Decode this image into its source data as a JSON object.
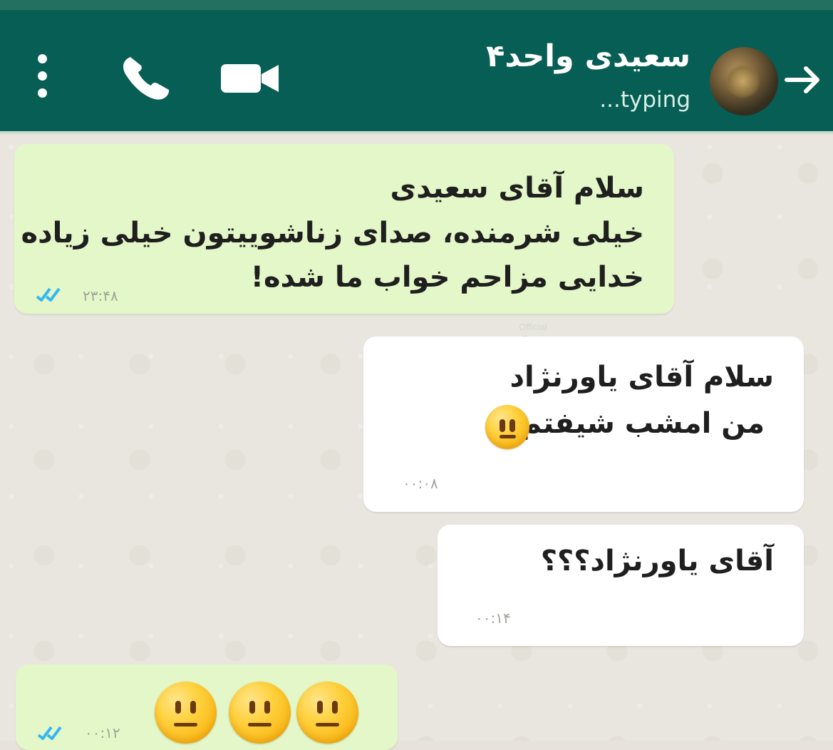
{
  "header": {
    "contact_name": "سعیدی واحد۴",
    "status": "...typing"
  },
  "messages": [
    {
      "direction": "outgoing",
      "lines": [
        "سلام آقای سعیدی",
        "خیلی شرمنده، صدای زناشوییتون خیلی زیاده",
        "خدایی مزاحم خواب ما شده!"
      ],
      "time": "۲۳:۴۸",
      "read": true
    },
    {
      "direction": "incoming",
      "lines": [
        "سلام آقای یاورنژاد",
        "من امشب شیفتم"
      ],
      "time": "۰۰:۰۸",
      "emoji": "neutral-face"
    },
    {
      "direction": "incoming",
      "lines": [
        "آقای یاورنژاد؟؟؟"
      ],
      "time": "۰۰:۱۴"
    },
    {
      "direction": "outgoing",
      "time": "۰۰:۱۲",
      "emoji": "neutral-face ×3",
      "read": true
    }
  ],
  "watermark": [
    "Official",
    "Persi"
  ],
  "colors": {
    "header": "#075e54",
    "outgoing_bubble": "#e4f7c8",
    "incoming_bubble": "#ffffff",
    "read_ticks": "#34b7f1"
  },
  "icons": [
    "back-arrow-icon",
    "avatar",
    "video-call-icon",
    "phone-icon",
    "more-options-icon",
    "double-check-icon",
    "neutral-face-emoji"
  ]
}
